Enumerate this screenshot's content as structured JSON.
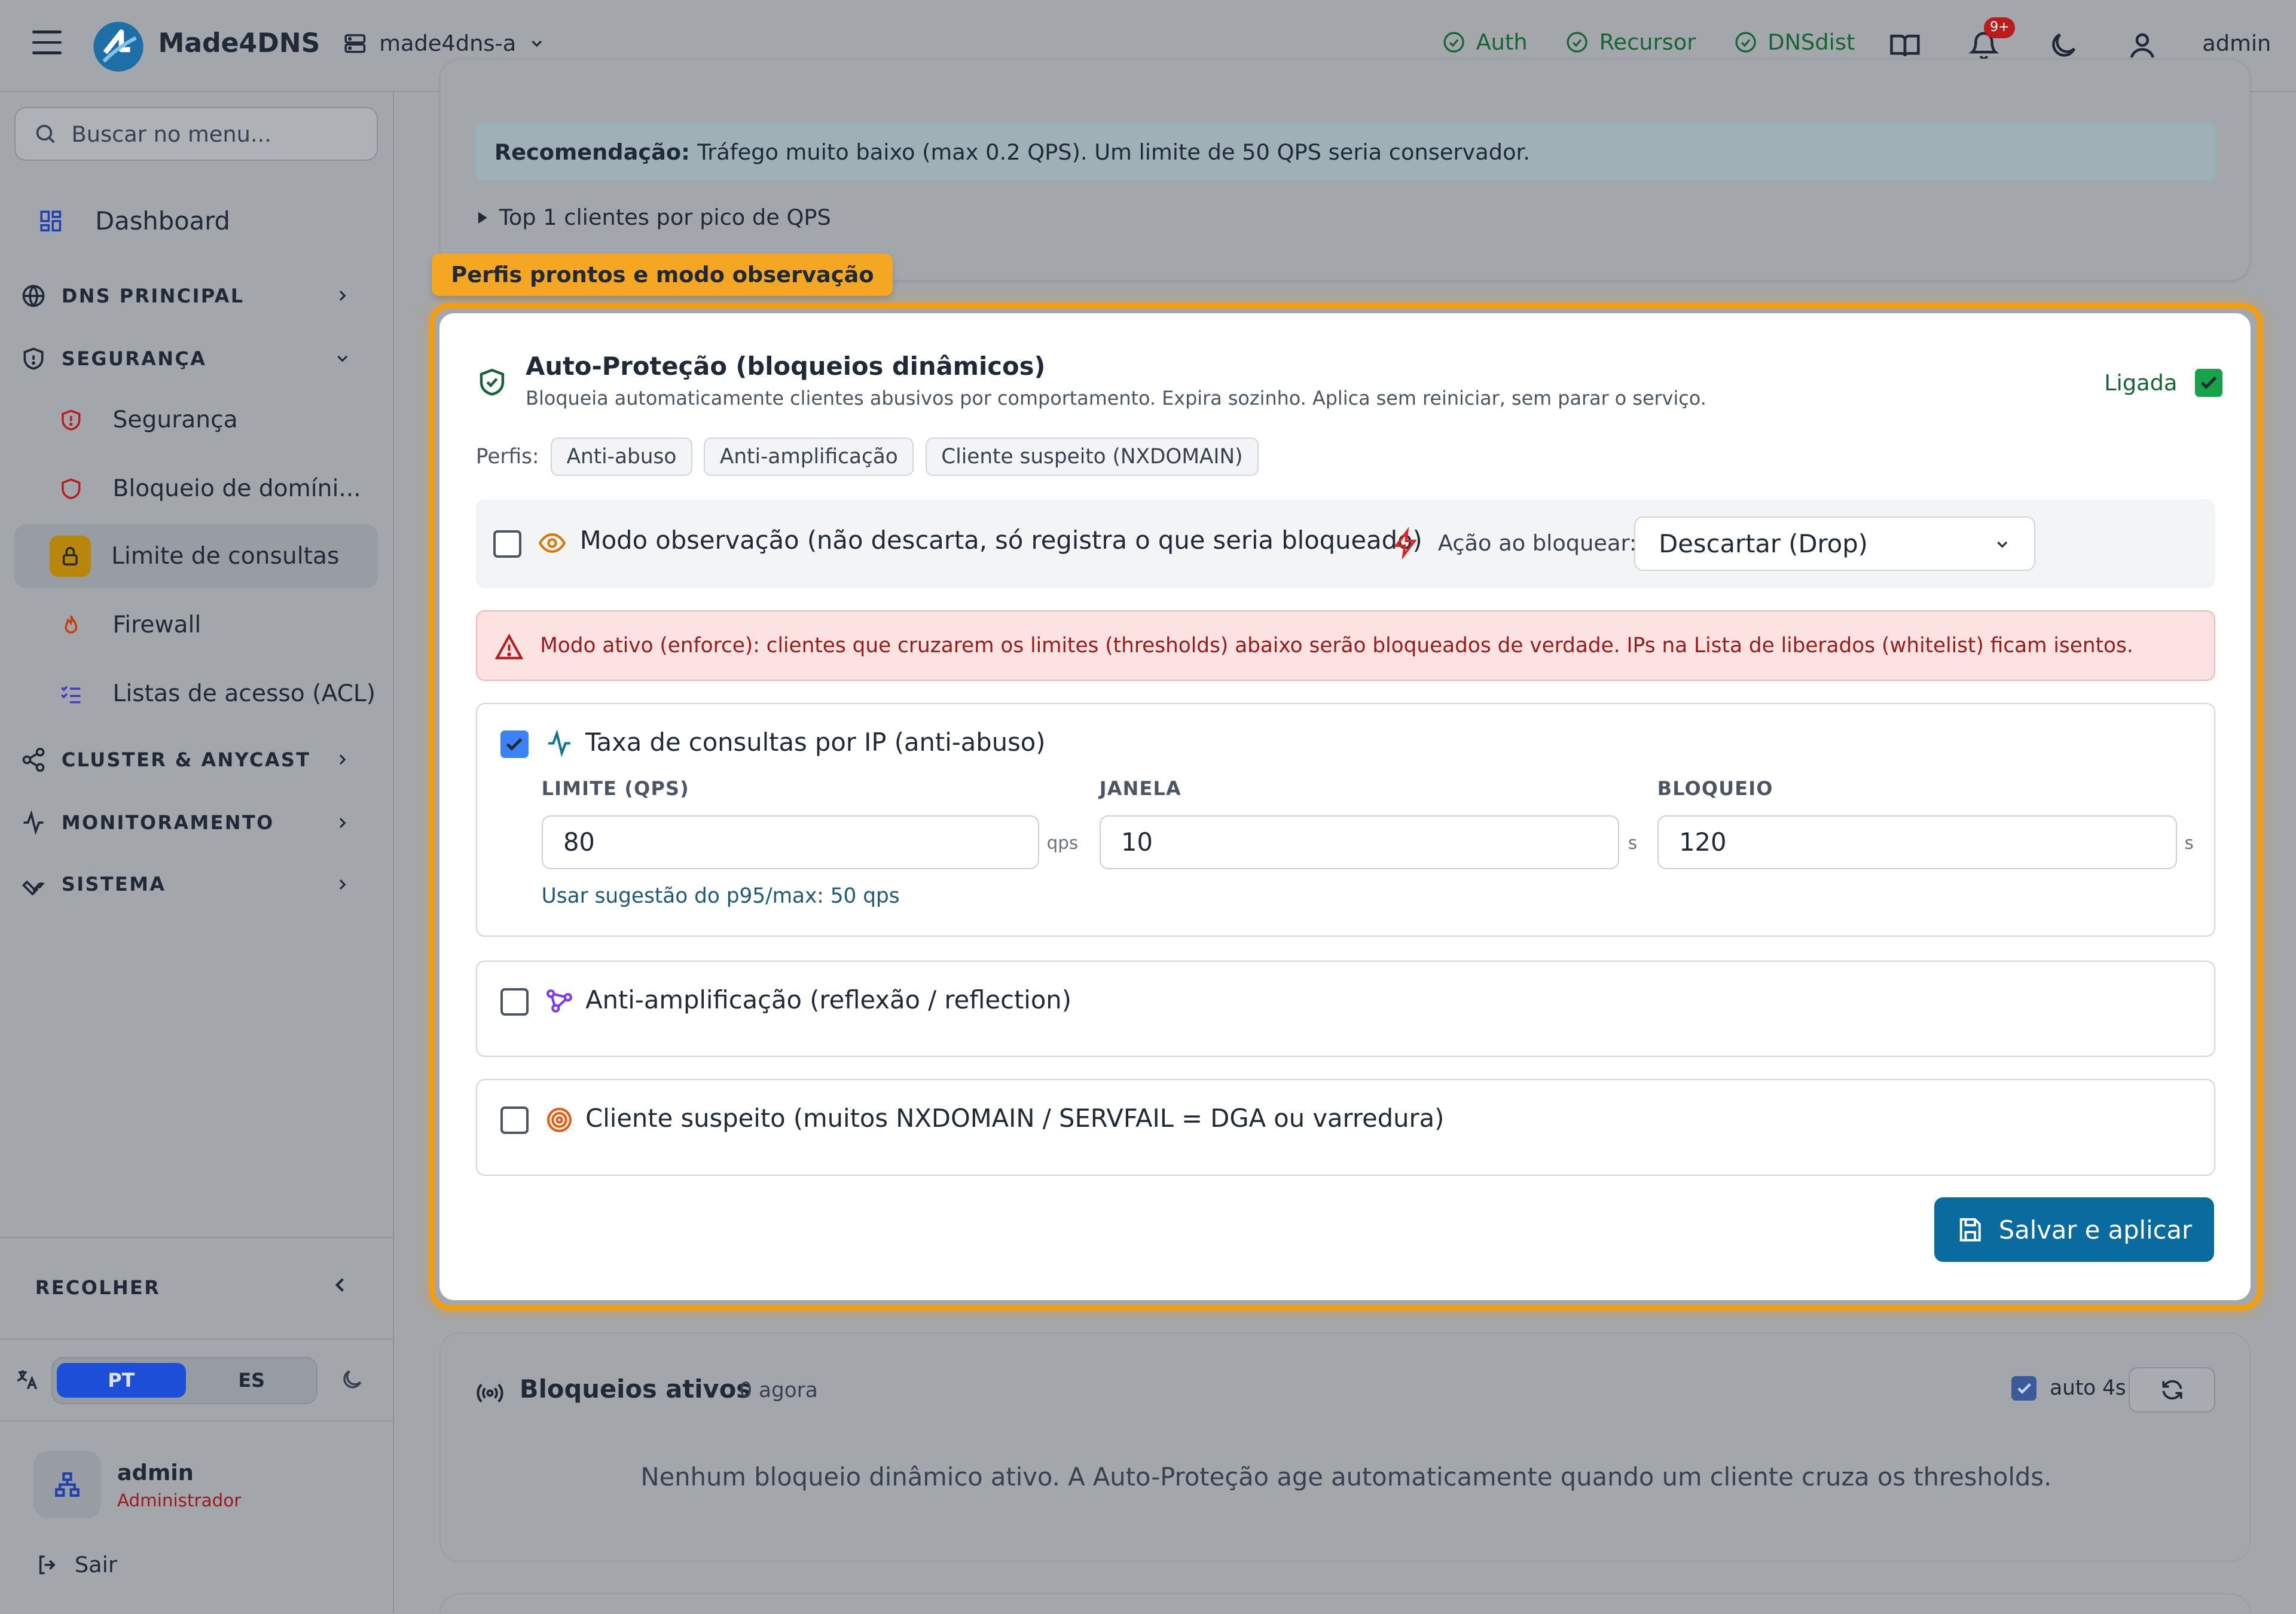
{
  "header": {
    "brand": "Made4DNS",
    "server": "made4dns-a",
    "status": [
      {
        "label": "Auth"
      },
      {
        "label": "Recursor"
      },
      {
        "label": "DNSdist"
      }
    ],
    "notif_badge": "9+",
    "user": "admin"
  },
  "sidebar": {
    "search_placeholder": "Buscar no menu...",
    "dashboard": "Dashboard",
    "sections": {
      "dns": "DNS PRINCIPAL",
      "security": "SEGURANÇA",
      "cluster": "CLUSTER & ANYCAST",
      "monitoring": "MONITORAMENTO",
      "system": "SISTEMA"
    },
    "security_items": [
      {
        "label": "Segurança"
      },
      {
        "label": "Bloqueio de domíni..."
      },
      {
        "label": "Limite de consultas"
      },
      {
        "label": "Firewall"
      },
      {
        "label": "Listas de acesso (ACL)"
      }
    ],
    "collapse": "RECOLHER",
    "lang_pt": "PT",
    "lang_es": "ES",
    "user_name": "admin",
    "user_role": "Administrador",
    "logout": "Sair"
  },
  "top_card": {
    "recomm_bold": "Recomendação:",
    "recomm_text": "Tráfego muito baixo (max 0.2 QPS). Um limite de 50 QPS seria conservador.",
    "top_clients": "Top 1 clientes por pico de QPS"
  },
  "tour_label": "Perfis prontos e modo observação",
  "auto_protect": {
    "title": "Auto-Proteção (bloqueios dinâmicos)",
    "desc": "Bloqueia automaticamente clientes abusivos por comportamento. Expira sozinho. Aplica sem reiniciar, sem parar o serviço.",
    "on_label": "Ligada",
    "profiles_label": "Perfis:",
    "profiles": [
      "Anti-abuso",
      "Anti-amplificação",
      "Cliente suspeito (NXDOMAIN)"
    ],
    "observe_label": "Modo observação (não descarta, só registra o que seria bloqueado)",
    "action_label": "Ação ao bloquear:",
    "action_value": "Descartar (Drop)",
    "alert": "Modo ativo (enforce): clientes que cruzarem os limites (thresholds) abaixo serão bloqueados de verdade. IPs na Lista de liberados (whitelist) ficam isentos.",
    "rate_rule": {
      "label": "Taxa de consultas por IP (anti-abuso)",
      "limit_label": "LIMITE (QPS)",
      "limit_value": "80",
      "limit_unit": "qps",
      "window_label": "JANELA",
      "window_value": "10",
      "window_unit": "s",
      "block_label": "BLOQUEIO",
      "block_value": "120",
      "block_unit": "s",
      "suggestion": "Usar sugestão do p95/max: 50 qps"
    },
    "amp_rule": "Anti-amplificação (reflexão / reflection)",
    "suspect_rule": "Cliente suspeito (muitos NXDOMAIN / SERVFAIL = DGA ou varredura)",
    "save": "Salvar e aplicar"
  },
  "active_blocks": {
    "title": "Bloqueios ativos",
    "count": "0 agora",
    "auto_label": "auto 4s",
    "empty": "Nenhum bloqueio dinâmico ativo. A Auto-Proteção age automaticamente quando um cliente cruza os thresholds."
  }
}
